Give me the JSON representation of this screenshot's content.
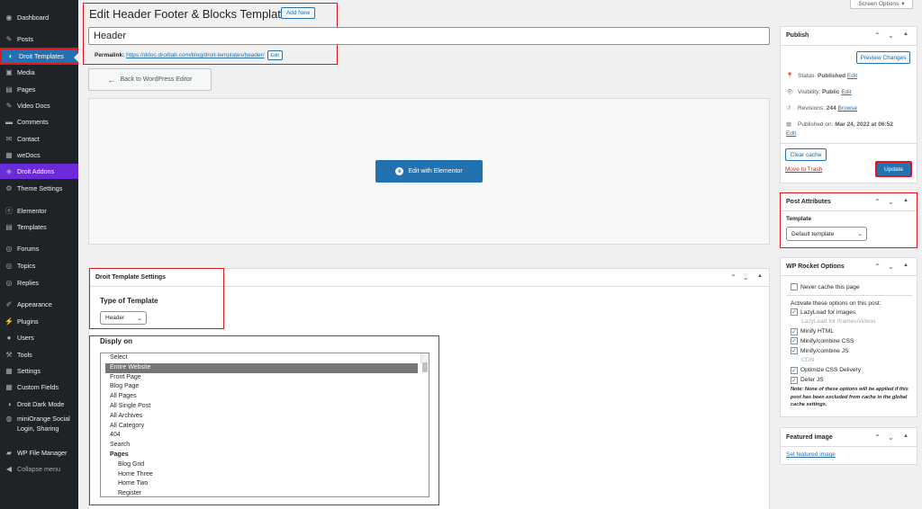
{
  "sidebar": {
    "items": [
      {
        "label": "Dashboard",
        "icon": "dashboard-icon"
      },
      {
        "label": "Posts",
        "icon": "pin-icon"
      },
      {
        "label": "Droit Templates",
        "icon": "template-icon"
      },
      {
        "label": "Media",
        "icon": "media-icon"
      },
      {
        "label": "Pages",
        "icon": "page-icon"
      },
      {
        "label": "Video Docs",
        "icon": "pin-icon"
      },
      {
        "label": "Comments",
        "icon": "comment-icon"
      },
      {
        "label": "Contact",
        "icon": "mail-icon"
      },
      {
        "label": "weDocs",
        "icon": "docs-icon"
      },
      {
        "label": "Droit Addons",
        "icon": "addons-icon"
      },
      {
        "label": "Theme Settings",
        "icon": "gear-icon"
      },
      {
        "label": "Elementor",
        "icon": "elementor-icon"
      },
      {
        "label": "Templates",
        "icon": "folder-icon"
      },
      {
        "label": "Forums",
        "icon": "forum-icon"
      },
      {
        "label": "Topics",
        "icon": "topic-icon"
      },
      {
        "label": "Replies",
        "icon": "reply-icon"
      },
      {
        "label": "Appearance",
        "icon": "brush-icon"
      },
      {
        "label": "Plugins",
        "icon": "plug-icon"
      },
      {
        "label": "Users",
        "icon": "user-icon"
      },
      {
        "label": "Tools",
        "icon": "wrench-icon"
      },
      {
        "label": "Settings",
        "icon": "settings-icon"
      },
      {
        "label": "Custom Fields",
        "icon": "fields-icon"
      },
      {
        "label": "Droit Dark Mode",
        "icon": "moon-icon"
      },
      {
        "label": "miniOrange Social Login, Sharing",
        "icon": "miniorange-icon"
      },
      {
        "label": "WP File Manager",
        "icon": "file-manager-icon"
      },
      {
        "label": "Collapse menu",
        "icon": "collapse-icon"
      }
    ]
  },
  "header": {
    "title": "Edit Header Footer & Blocks Template",
    "add_new": "Add New",
    "screen_options": "Screen Options"
  },
  "post": {
    "title_value": "Header",
    "permalink_label": "Permalink:",
    "permalink_url": "https://ddoc.droitlab.com/blog/droit-templates/header/",
    "edit": "Edit",
    "back_button": "Back to WordPress Editor",
    "elementor_button": "Edit with Elementor"
  },
  "template_settings": {
    "title": "Droit Template Settings",
    "type_label": "Type of Template",
    "type_value": "Header",
    "display_label": "Disply on",
    "options": [
      {
        "label": "Select",
        "kind": "opt"
      },
      {
        "label": "Entire Website",
        "kind": "selected"
      },
      {
        "label": "Front Page",
        "kind": "opt"
      },
      {
        "label": "Blog Page",
        "kind": "opt"
      },
      {
        "label": "All Pages",
        "kind": "opt"
      },
      {
        "label": "All Single Post",
        "kind": "opt"
      },
      {
        "label": "All Archives",
        "kind": "opt"
      },
      {
        "label": "All Category",
        "kind": "opt"
      },
      {
        "label": "404",
        "kind": "opt"
      },
      {
        "label": "Search",
        "kind": "opt"
      },
      {
        "label": "Pages",
        "kind": "group"
      },
      {
        "label": "Blog Grid",
        "kind": "sub"
      },
      {
        "label": "Home Three",
        "kind": "sub"
      },
      {
        "label": "Home Two",
        "kind": "sub"
      },
      {
        "label": "Register",
        "kind": "sub"
      }
    ]
  },
  "publish": {
    "title": "Publish",
    "preview": "Preview Changes",
    "status_label": "Status:",
    "status_value": "Published",
    "status_edit": "Edit",
    "visibility_label": "Visibility:",
    "visibility_value": "Public",
    "visibility_edit": "Edit",
    "revisions_label": "Revisions:",
    "revisions_value": "244",
    "revisions_browse": "Browse",
    "published_on": "Published on:",
    "published_date": "Mar 24, 2022 at 06:52",
    "published_edit": "Edit",
    "clear_cache": "Clear cache",
    "move_to_trash": "Move to Trash",
    "update": "Update"
  },
  "attributes": {
    "title": "Post Attributes",
    "template_label": "Template",
    "template_value": "Default template"
  },
  "wprocket": {
    "title": "WP Rocket Options",
    "never_cache": "Never cache this page",
    "activate_label": "Activate these options on this post:",
    "options": [
      {
        "label": "LazyLoad for images",
        "checked": true
      },
      {
        "label": "LazyLoad for iframes/videos",
        "checked": false,
        "disabled": true
      },
      {
        "label": "Minify HTML",
        "checked": true
      },
      {
        "label": "Minify/combine CSS",
        "checked": true
      },
      {
        "label": "Minify/combine JS",
        "checked": true
      },
      {
        "label": "CDN",
        "checked": false,
        "disabled": true
      },
      {
        "label": "Optimize CSS Delivery",
        "checked": true
      },
      {
        "label": "Defer JS",
        "checked": true
      }
    ],
    "note": "Note: None of these options will be applied if this post has been excluded from cache in the global cache settings."
  },
  "featured": {
    "title": "Featured image",
    "set_link": "Set featured image"
  },
  "colors": {
    "accent": "#2271b1",
    "sidebar_bg": "#1d2327",
    "highlight": "#e3161c",
    "purple": "#6c2bd9",
    "elementor": "#2271b1"
  }
}
